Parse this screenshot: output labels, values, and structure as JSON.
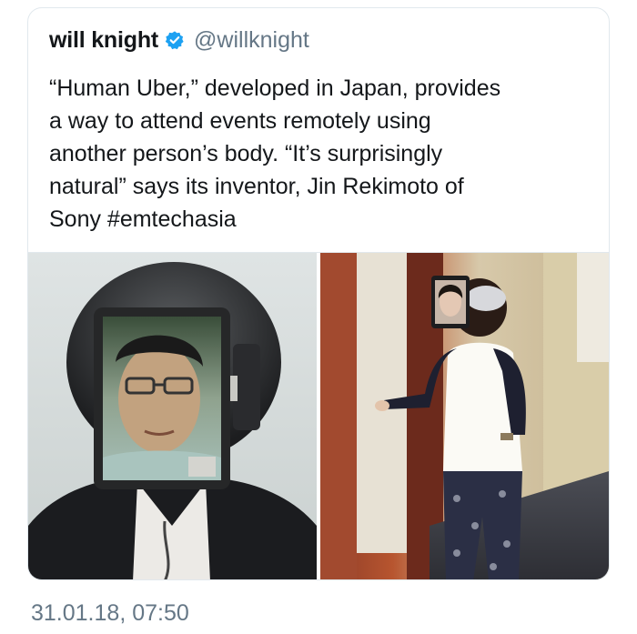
{
  "tweet": {
    "display_name": "will knight",
    "verified_icon": "verified-badge-icon",
    "handle": "@willknight",
    "text": "“Human Uber,” developed in Japan, provides\na way to attend events remotely using\nanother person’s body. “It’s surprisingly\nnatural” says its inventor, Jin Rekimoto of\nSony #emtechasia",
    "timestamp": "31.01.18, 07:50"
  },
  "colors": {
    "text_primary": "#14171a",
    "text_secondary": "#657786",
    "verified_blue": "#1da1f2",
    "border": "#e1e8ed"
  },
  "media": {
    "photos": [
      {
        "name": "photo-man-wearing-helmet-with-tablet-face"
      },
      {
        "name": "photo-woman-in-hallway-with-tablet-face"
      }
    ]
  }
}
